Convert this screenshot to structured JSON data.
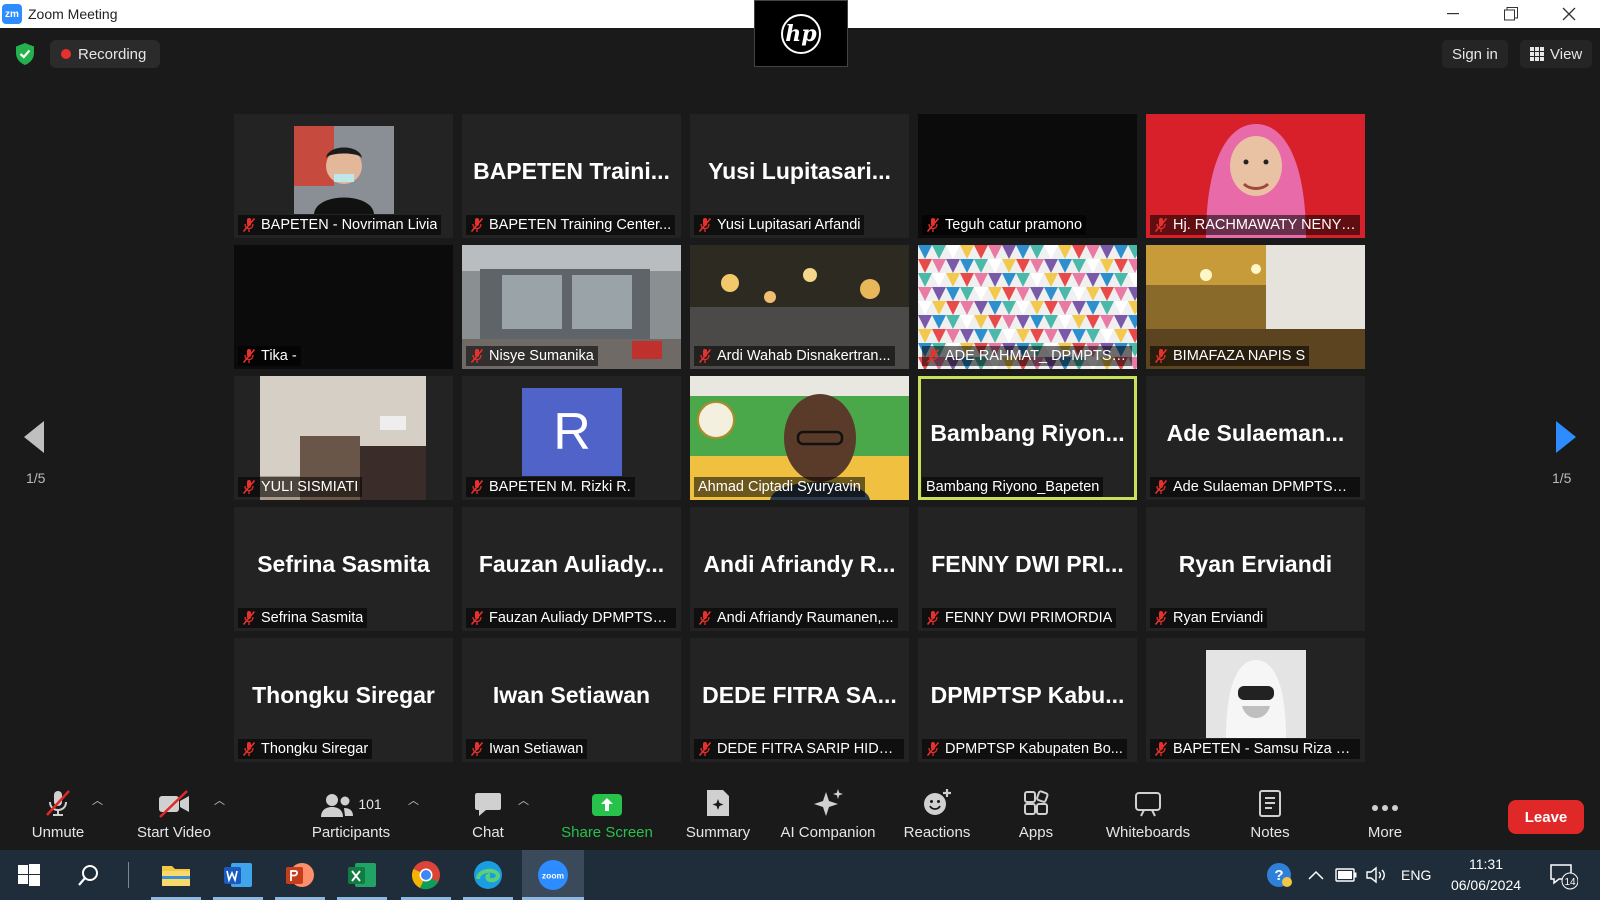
{
  "window": {
    "title": "Zoom Meeting",
    "logo_text": "zm",
    "brand_logo": "hp"
  },
  "topbar": {
    "recording_label": "Recording",
    "sign_in_label": "Sign in",
    "view_label": "View"
  },
  "pager": {
    "left": "1/5",
    "right": "1/5"
  },
  "tiles": [
    {
      "name": "",
      "label": "BAPETEN - Novriman Livia",
      "muted": true,
      "kind": "photo-man"
    },
    {
      "name": "BAPETEN Traini...",
      "label": "BAPETEN Training Center...",
      "muted": true,
      "kind": "name"
    },
    {
      "name": "Yusi Lupitasari...",
      "label": "Yusi Lupitasari Arfandi",
      "muted": true,
      "kind": "name"
    },
    {
      "name": "",
      "label": "Teguh catur pramono",
      "muted": true,
      "kind": "black"
    },
    {
      "name": "",
      "label": "Hj. RACHMAWATY NENY ...",
      "muted": true,
      "kind": "photo-hijab"
    },
    {
      "name": "",
      "label": "Tika -",
      "muted": true,
      "kind": "black"
    },
    {
      "name": "",
      "label": "Nisye Sumanika",
      "muted": true,
      "kind": "video-office"
    },
    {
      "name": "",
      "label": "Ardi Wahab Disnakertran...",
      "muted": true,
      "kind": "video-cafe"
    },
    {
      "name": "",
      "label": "ADE RAHMAT_ DPMPTSP ...",
      "muted": true,
      "kind": "video-pattern"
    },
    {
      "name": "",
      "label": "BIMAFAZA NAPIS S",
      "muted": true,
      "kind": "video-room"
    },
    {
      "name": "",
      "label": "YULI SISMIATI",
      "muted": true,
      "kind": "video-bedroom"
    },
    {
      "name": "R",
      "label": "BAPETEN M. Rizki R.",
      "muted": true,
      "kind": "avatar"
    },
    {
      "name": "",
      "label": "Ahmad Ciptadi Syuryavin",
      "muted": false,
      "kind": "video-speaker"
    },
    {
      "name": "Bambang Riyon...",
      "label": "Bambang Riyono_Bapeten",
      "muted": false,
      "kind": "name",
      "active": true
    },
    {
      "name": "Ade Sulaeman...",
      "label": "Ade Sulaeman DPMPTSP ...",
      "muted": true,
      "kind": "name"
    },
    {
      "name": "Sefrina Sasmita",
      "label": "Sefrina Sasmita",
      "muted": true,
      "kind": "name"
    },
    {
      "name": "Fauzan Auliady...",
      "label": "Fauzan Auliady DPMPTSP...",
      "muted": true,
      "kind": "name"
    },
    {
      "name": "Andi Afriandy R...",
      "label": "Andi Afriandy Raumanen,...",
      "muted": true,
      "kind": "name"
    },
    {
      "name": "FENNY DWI PRI...",
      "label": "FENNY DWI PRIMORDIA",
      "muted": true,
      "kind": "name"
    },
    {
      "name": "Ryan Erviandi",
      "label": "Ryan Erviandi",
      "muted": true,
      "kind": "name"
    },
    {
      "name": "Thongku Siregar",
      "label": "Thongku Siregar",
      "muted": true,
      "kind": "name"
    },
    {
      "name": "Iwan Setiawan",
      "label": "Iwan Setiawan",
      "muted": true,
      "kind": "name"
    },
    {
      "name": "DEDE FITRA SA...",
      "label": "DEDE FITRA SARIP HIDAY...",
      "muted": true,
      "kind": "name"
    },
    {
      "name": "DPMPTSP Kabu...",
      "label": "DPMPTSP Kabupaten Bo...",
      "muted": true,
      "kind": "name"
    },
    {
      "name": "",
      "label": "BAPETEN - Samsu Riza W...",
      "muted": true,
      "kind": "photo-ppe"
    }
  ],
  "toolbar": {
    "unmute": "Unmute",
    "start_video": "Start Video",
    "participants": "Participants",
    "participants_count": "101",
    "chat": "Chat",
    "share_screen": "Share Screen",
    "summary": "Summary",
    "ai_companion": "AI Companion",
    "reactions": "Reactions",
    "apps": "Apps",
    "whiteboards": "Whiteboards",
    "notes": "Notes",
    "more": "More",
    "leave": "Leave"
  },
  "taskbar": {
    "language": "ENG",
    "time": "11:31",
    "date": "06/06/2024",
    "notification_count": "14",
    "zoom_label": "zoom"
  },
  "colors": {
    "accent_green": "#27c24c",
    "leave_red": "#e02828",
    "active_speaker": "#c8e05a",
    "zoom_blue": "#2d8cff"
  }
}
